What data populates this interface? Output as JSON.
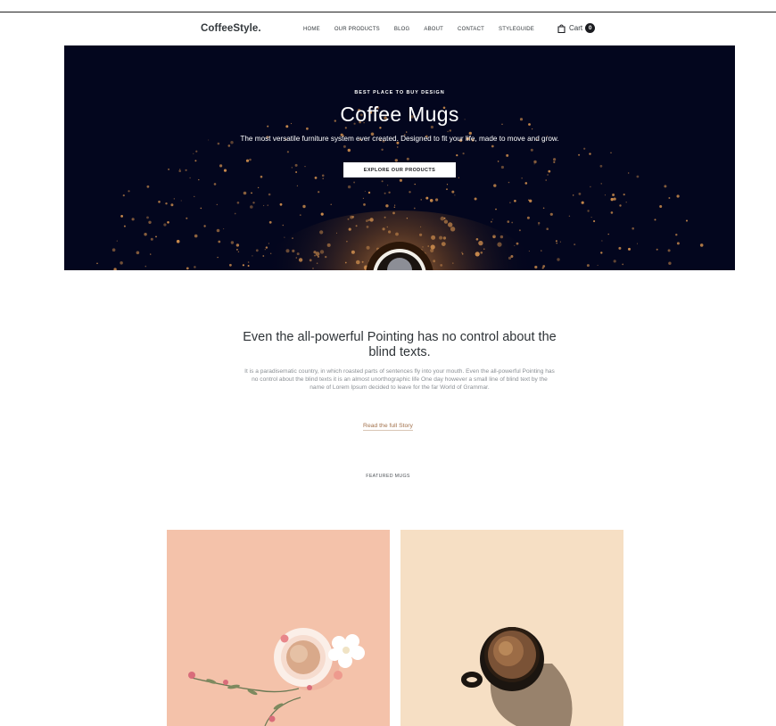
{
  "brand": {
    "logo": "CoffeeStyle."
  },
  "nav": {
    "items": [
      {
        "label": "HOME"
      },
      {
        "label": "OUR PRODUCTS"
      },
      {
        "label": "BLOG"
      },
      {
        "label": "ABOUT"
      },
      {
        "label": "CONTACT"
      },
      {
        "label": "STYLEGUIDE"
      }
    ],
    "cart": {
      "label": "Cart",
      "count": "0"
    }
  },
  "hero": {
    "eyebrow": "BEST PLACE TO BUY DESIGN",
    "title": "Coffee Mugs",
    "subtitle": "The most versatile furniture system ever created. Designed to fit your life, made to move and grow.",
    "button_label": "EXPLORE OUR PRODUCTS",
    "background_color": "#03061e"
  },
  "intro": {
    "heading": "Even the all-powerful Pointing has no control about the blind texts.",
    "body": "It is a paradisematic country, in which roasted parts of sentences fly into your mouth. Even the all-powerful Pointing has no control about the blind texts it is an almost unorthographic life One day however a small line of blind text by the name of Lorem Ipsum decided to leave for the far World of Grammar.",
    "link_label": "Read the full Story",
    "link_color": "#a2714b"
  },
  "featured": {
    "label": "FEATURED MUGS",
    "products": [
      {
        "image": "pink-cup-with-flowers",
        "background": "#f4c2aa"
      },
      {
        "image": "black-coffee-mug",
        "background": "#f6dfc4"
      }
    ]
  }
}
